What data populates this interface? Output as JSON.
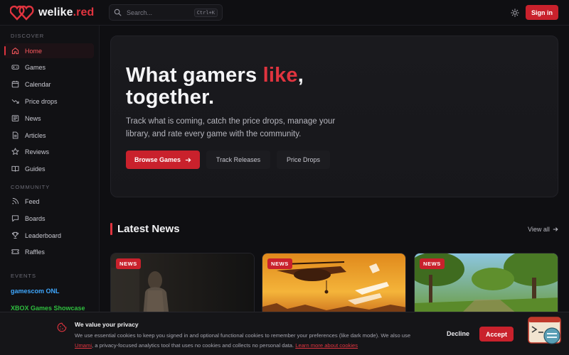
{
  "brand": {
    "name_main": "welike",
    "name_tld": ".red",
    "accent": "#e0343f"
  },
  "header": {
    "search_placeholder": "Search...",
    "search_shortcut": "Ctrl+K",
    "theme_icon": "sun-icon",
    "signin_label": "Sign in"
  },
  "sidebar": {
    "discover_title": "DISCOVER",
    "discover_items": [
      {
        "label": "Home",
        "icon": "home-icon",
        "active": true
      },
      {
        "label": "Games",
        "icon": "gamepad-icon"
      },
      {
        "label": "Calendar",
        "icon": "calendar-icon"
      },
      {
        "label": "Price drops",
        "icon": "trending-down-icon"
      },
      {
        "label": "News",
        "icon": "newspaper-icon"
      },
      {
        "label": "Articles",
        "icon": "file-text-icon"
      },
      {
        "label": "Reviews",
        "icon": "star-icon"
      },
      {
        "label": "Guides",
        "icon": "book-open-icon"
      }
    ],
    "community_title": "COMMUNITY",
    "community_items": [
      {
        "label": "Feed",
        "icon": "rss-icon"
      },
      {
        "label": "Boards",
        "icon": "message-square-icon"
      },
      {
        "label": "Leaderboard",
        "icon": "trophy-icon"
      },
      {
        "label": "Raffles",
        "icon": "ticket-icon"
      }
    ],
    "events_title": "EVENTS",
    "events": [
      {
        "label": "gamescom ONL",
        "color": "#3fa8ff"
      },
      {
        "label": "XBOX Games Showcase",
        "color": "#2fbf3f"
      }
    ]
  },
  "hero": {
    "title_part1": "What gamers ",
    "title_highlight": "like",
    "title_part2": ",",
    "title_line2": "together.",
    "subtitle": "Track what is coming, catch the price drops, manage your library, and rate every game with the community.",
    "primary_label": "Browse Games",
    "secondary_labels": [
      "Track Releases",
      "Price Drops"
    ]
  },
  "latest_news": {
    "title": "Latest News",
    "view_all": "View all",
    "cards": [
      {
        "badge": "NEWS"
      },
      {
        "badge": "NEWS"
      },
      {
        "badge": "NEWS"
      }
    ]
  },
  "cookie": {
    "title": "We value your privacy",
    "text_before": "We use essential cookies to keep you signed in and optional functional cookies to remember your preferences (like dark mode). We also use ",
    "link1": "Umami",
    "text_middle": ", a privacy-focused analytics tool that uses no cookies and collects no personal data. ",
    "link2": "Learn more about cookies",
    "decline_label": "Decline",
    "accept_label": "Accept"
  }
}
